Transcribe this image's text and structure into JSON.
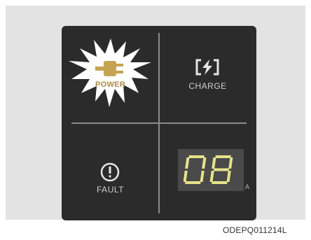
{
  "panel": {
    "power_label": "POWER",
    "charge_label": "CHARGE",
    "fault_label": "FAULT",
    "display_value": "08",
    "display_unit": "A",
    "power_icon": "plug-icon",
    "charge_icon": "lightning-bracket-icon",
    "fault_icon": "exclamation-circle-icon",
    "power_state": "on",
    "colors": {
      "panel_bg": "#2b2b2b",
      "power_glow": "#ffffff",
      "power_icon": "#c4a453",
      "lcd_digits": "#e6e38a",
      "text": "#cfcfcf"
    }
  },
  "caption": "ODEPQ011214L"
}
